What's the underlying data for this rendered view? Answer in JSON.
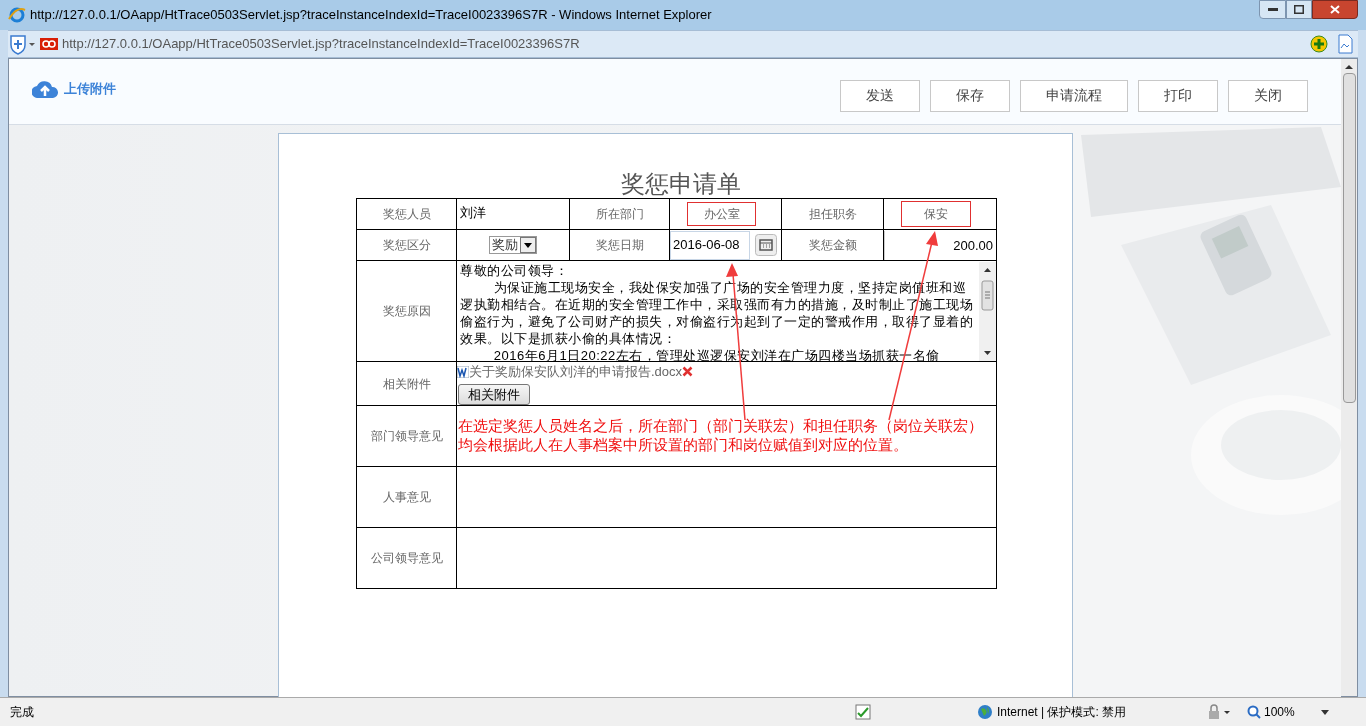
{
  "window": {
    "title": "http://127.0.0.1/OAapp/HtTrace0503Servlet.jsp?traceInstanceIndexId=TraceI0023396S7R - Windows Internet Explorer"
  },
  "address_bar": {
    "url": "http://127.0.0.1/OAapp/HtTrace0503Servlet.jsp?traceInstanceIndexId=TraceI0023396S7R"
  },
  "toolbar": {
    "upload_label": "上传附件",
    "buttons": [
      "发送",
      "保存",
      "申请流程",
      "打印",
      "关闭"
    ]
  },
  "form": {
    "title": "奖惩申请单",
    "person_label": "奖惩人员",
    "person": "刘洋",
    "dept_label": "所在部门",
    "dept": "办公室",
    "post_label": "担任职务",
    "post": "保安",
    "type_label": "奖惩区分",
    "type": "奖励",
    "date_label": "奖惩日期",
    "date": "2016-06-08",
    "amount_label": "奖惩金额",
    "amount": "200.00",
    "reason_label": "奖惩原因",
    "reason": [
      "尊敬的公司领导：",
      "为保证施工现场安全，我处保安加强了广场的安全管理力度，坚持定岗值班和巡逻执勤相结合。在近期的安全管理工作中，采取强而有力的措施，及时制止了施工现场偷盗行为，避免了公司财产的损失，对偷盗行为起到了一定的警戒作用，取得了显着的效果。以下是抓获小偷的具体情况：",
      "2016年6月1日20:22左右，管理处巡逻保安刘洋在广场四楼当场抓获一名偷"
    ],
    "attachment_label": "相关附件",
    "attachment_file": "关于奖励保安队刘洋的申请报告.docx",
    "attachment_button": "相关附件",
    "dept_opinion_label": "部门领导意见",
    "hr_opinion_label": "人事意见",
    "company_opinion_label": "公司领导意见"
  },
  "annotation": {
    "lines": [
      "在选定奖惩人员姓名之后，所在部门（部门关联宏）和担任职务（岗位关联宏）",
      "均会根据此人在人事档案中所设置的部门和岗位赋值到对应的位置。"
    ]
  },
  "status_bar": {
    "status": "完成",
    "zone": "Internet | 保护模式: 禁用",
    "zoom": "100%"
  }
}
